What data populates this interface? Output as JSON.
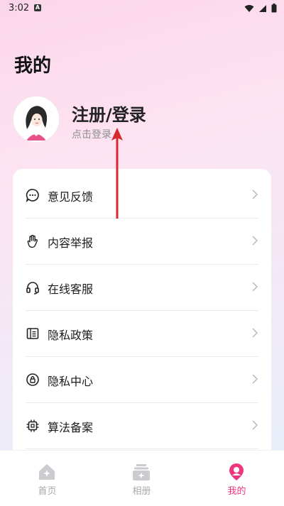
{
  "status_bar": {
    "time": "3:02",
    "notif_glyph": "A"
  },
  "page": {
    "title": "我的"
  },
  "profile": {
    "title": "注册/登录",
    "subtitle": "点击登录"
  },
  "menu": {
    "items": [
      {
        "label": "意见反馈",
        "icon": "chat-bubble-icon"
      },
      {
        "label": "内容举报",
        "icon": "hand-icon"
      },
      {
        "label": "在线客服",
        "icon": "headset-icon"
      },
      {
        "label": "隐私政策",
        "icon": "document-icon"
      },
      {
        "label": "隐私中心",
        "icon": "privacy-shield-icon"
      },
      {
        "label": "算法备案",
        "icon": "chip-icon"
      }
    ]
  },
  "tab_bar": {
    "tabs": [
      {
        "label": "首页",
        "active": false
      },
      {
        "label": "相册",
        "active": false
      },
      {
        "label": "我的",
        "active": true
      }
    ]
  },
  "colors": {
    "accent": "#f0357f",
    "inactive": "#a8a8ad",
    "arrow": "#d9272e"
  }
}
